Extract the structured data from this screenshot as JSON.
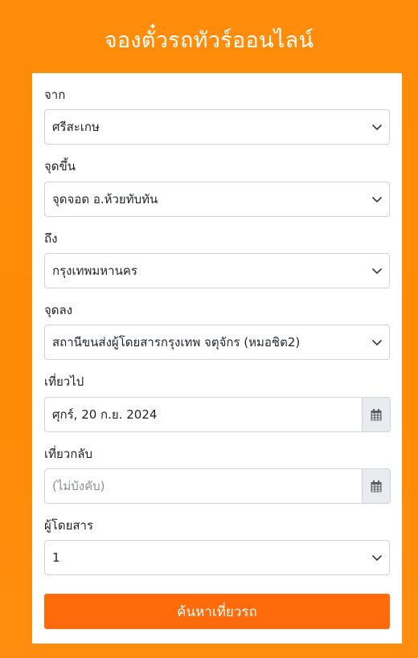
{
  "page": {
    "title": "จองตั๋วรถทัวร์ออนไลน์"
  },
  "form": {
    "from": {
      "label": "จาก",
      "value": "ศรีสะเกษ"
    },
    "pickup": {
      "label": "จุดขึ้น",
      "value": "จุดจอด อ.ห้วยทับทัน"
    },
    "to": {
      "label": "ถึง",
      "value": "กรุงเทพมหานคร"
    },
    "dropoff": {
      "label": "จุดลง",
      "value": "สถานีขนส่งผู้โดยสารกรุงเทพ จตุจักร (หมอชิต2)"
    },
    "depart": {
      "label": "เที่ยวไป",
      "value": "ศุกร์, 20 ก.ย. 2024"
    },
    "return": {
      "label": "เที่ยวกลับ",
      "placeholder": "(ไม่บังคับ)"
    },
    "passengers": {
      "label": "ผู้โดยสาร",
      "value": "1"
    },
    "search_button": "ค้นหาเที่ยวรถ"
  },
  "icons": {
    "dropdown": "chevron-down-icon",
    "calendar": "calendar-icon"
  },
  "colors": {
    "background": "#ff8a05",
    "button": "#ff6a0a",
    "addon": "#e9ecef"
  }
}
